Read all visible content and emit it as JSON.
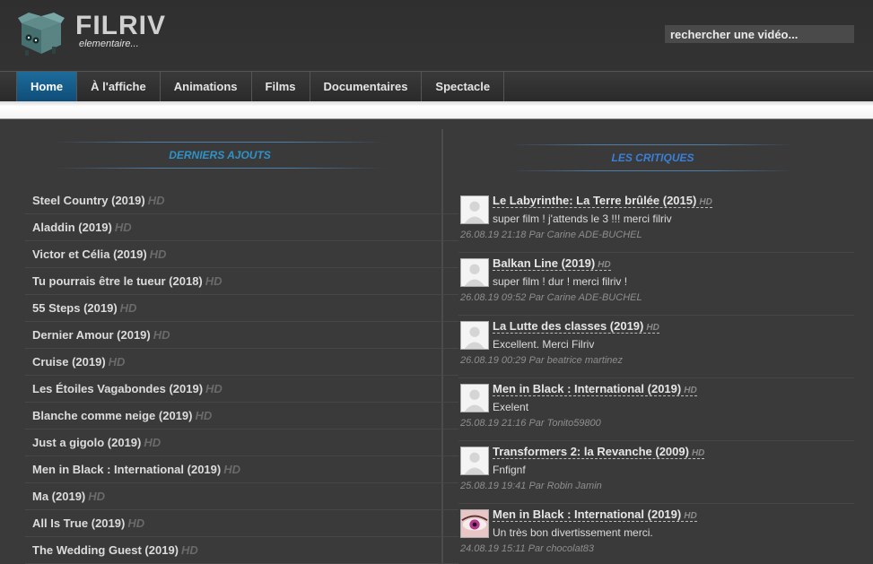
{
  "header": {
    "logo_title": "FILRIV",
    "logo_subtitle": "elementaire...",
    "search_placeholder": "rechercher une vidéo..."
  },
  "nav": {
    "items": [
      {
        "label": "Home",
        "active": true
      },
      {
        "label": "À l'affiche"
      },
      {
        "label": "Animations"
      },
      {
        "label": "Films"
      },
      {
        "label": "Documentaires"
      },
      {
        "label": "Spectacle"
      }
    ]
  },
  "latest": {
    "title": "DERNIERS AJOUTS",
    "badge": "HD",
    "items": [
      "Steel Country (2019)",
      "Aladdin (2019)",
      "Victor et Célia (2019)",
      "Tu pourrais être le tueur (2018)",
      "55 Steps (2019)",
      "Dernier Amour (2019)",
      "Cruise (2019)",
      "Les Étoiles Vagabondes (2019)",
      "Blanche comme neige (2019)",
      "Just a gigolo (2019)",
      "Men in Black : International (2019)",
      "Ma (2019)",
      "All Is True (2019)",
      "The Wedding Guest (2019)"
    ]
  },
  "reviews": {
    "title": "LES CRITIQUES",
    "badge": "HD",
    "items": [
      {
        "film": "Le Labyrinthe: La Terre brûlée (2015)",
        "text": "super film ! j'attends le 3 !!! merci filriv",
        "meta": "26.08.19 21:18 Par Carine ADE-BUCHEL",
        "avatar": "default"
      },
      {
        "film": "Balkan Line (2019)",
        "text": "super film ! dur ! merci filriv !",
        "meta": "26.08.19 09:52 Par Carine ADE-BUCHEL",
        "avatar": "default"
      },
      {
        "film": "La Lutte des classes (2019)",
        "text": "Excellent. Merci Filriv",
        "meta": "26.08.19 00:29 Par beatrice martinez",
        "avatar": "default"
      },
      {
        "film": "Men in Black : International (2019)",
        "text": "Exelent",
        "meta": "25.08.19 21:16 Par Tonito59800",
        "avatar": "default"
      },
      {
        "film": "Transformers 2: la Revanche (2009)",
        "text": "Fnfignf",
        "meta": "25.08.19 19:41 Par Robin Jamin",
        "avatar": "default"
      },
      {
        "film": "Men in Black : International (2019)",
        "text": "Un très bon divertissement merci.",
        "meta": "24.08.19 15:11 Par chocolat83",
        "avatar": "eye"
      }
    ]
  },
  "colors": {
    "nav_active": "#1d6c9c",
    "section_title_left": "#2e93c9",
    "section_title_right": "#3b7fd6",
    "background": "#3a3a3a"
  }
}
